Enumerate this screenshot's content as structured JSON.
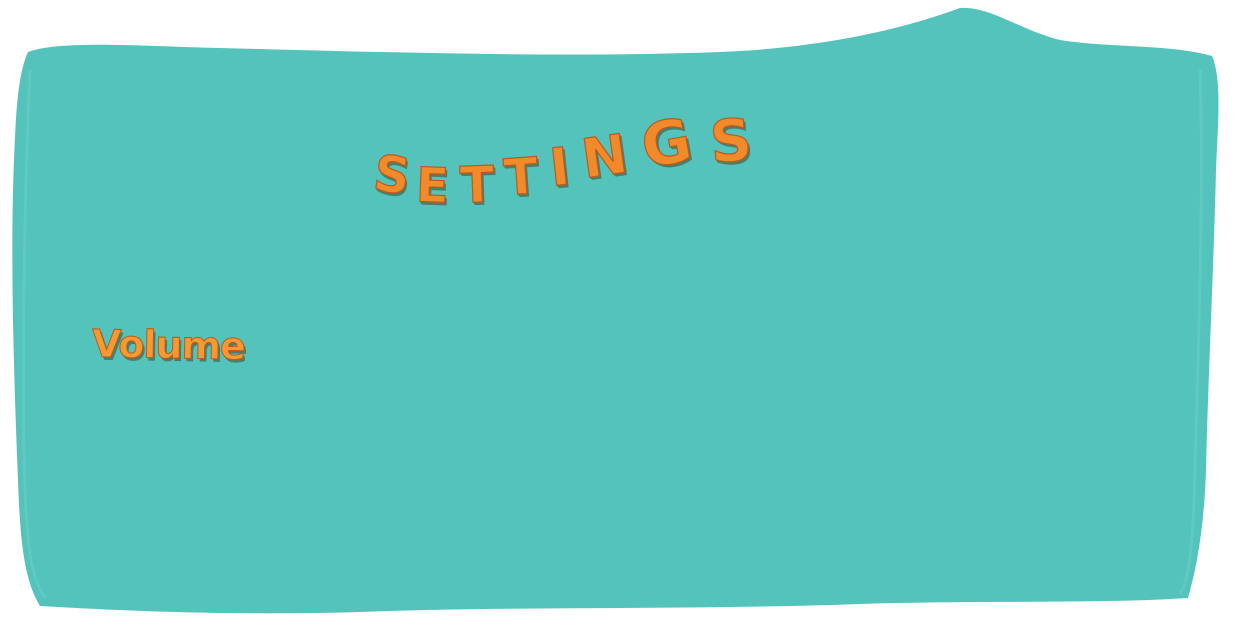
{
  "screen": {
    "title": "SETTINGS",
    "panel_color": "#54c3bb",
    "text_color": "#f08a2a",
    "shadow_color": "#4a7f6a"
  },
  "settings": {
    "volume_label": "Volume"
  }
}
